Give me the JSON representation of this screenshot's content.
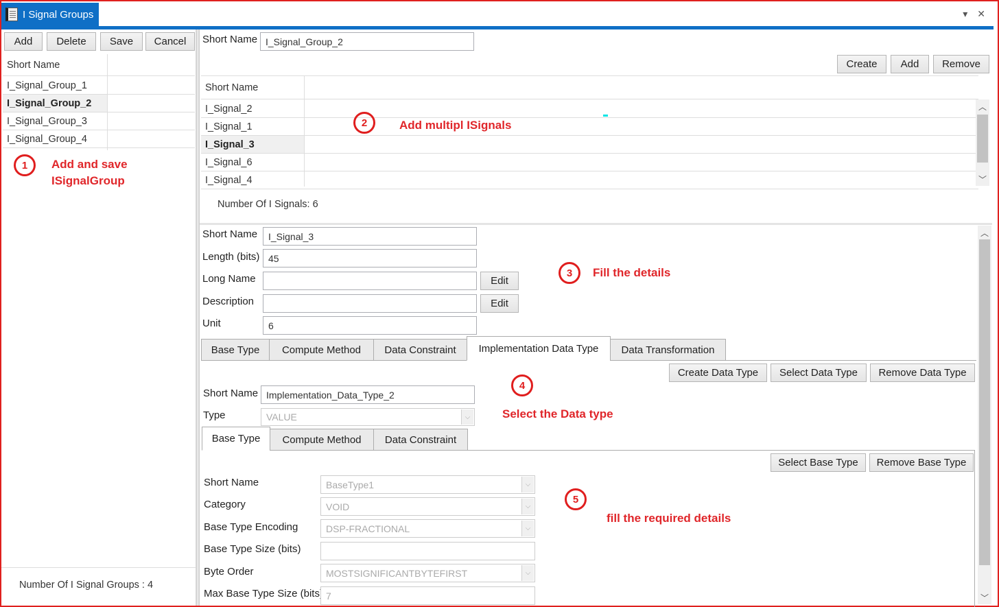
{
  "window": {
    "title": "I Signal Groups",
    "icon": "document-icon",
    "controls": {
      "menu_icon": "▾",
      "close_icon": "✕"
    }
  },
  "left": {
    "buttons": {
      "add": "Add",
      "delete": "Delete",
      "save": "Save",
      "cancel": "Cancel"
    },
    "grid": {
      "header": "Short Name",
      "rows": [
        "I_Signal_Group_1",
        "I_Signal_Group_2",
        "I_Signal_Group_3",
        "I_Signal_Group_4"
      ],
      "selected_index": 1
    },
    "count_label": "Number Of I Signal Groups : 4"
  },
  "group": {
    "short_name_label": "Short Name",
    "short_name_value": "I_Signal_Group_2",
    "buttons": {
      "create": "Create",
      "add": "Add",
      "remove": "Remove"
    },
    "grid": {
      "header": "Short Name",
      "rows": [
        "I_Signal_2",
        "I_Signal_1",
        "I_Signal_3",
        "I_Signal_6",
        "I_Signal_4"
      ],
      "selected_index": 2
    },
    "count_label": "Number Of I Signals: 6"
  },
  "signal": {
    "short_name_label": "Short Name",
    "short_name_value": "I_Signal_3",
    "length_label": "Length (bits)",
    "length_value": "45",
    "long_name_label": "Long Name",
    "long_name_value": "",
    "description_label": "Description",
    "description_value": "",
    "unit_label": "Unit",
    "unit_value": "6",
    "edit_label": "Edit",
    "tabs": [
      "Base Type",
      "Compute Method",
      "Data Constraint",
      "Implementation Data Type",
      "Data Transformation"
    ],
    "active_tab": 3
  },
  "impl_type": {
    "buttons": {
      "create": "Create Data Type",
      "select": "Select Data Type",
      "remove": "Remove Data Type"
    },
    "short_name_label": "Short Name",
    "short_name_value": "Implementation_Data_Type_2",
    "type_label": "Type",
    "type_value": "VALUE",
    "tabs": [
      "Base Type",
      "Compute Method",
      "Data Constraint"
    ],
    "active_tab": 0
  },
  "base_type": {
    "buttons": {
      "select": "Select Base Type",
      "remove": "Remove Base Type"
    },
    "fields": [
      {
        "label": "Short Name",
        "value": "BaseType1",
        "kind": "combo"
      },
      {
        "label": "Category",
        "value": "VOID",
        "kind": "combo"
      },
      {
        "label": "Base Type Encoding",
        "value": "DSP-FRACTIONAL",
        "kind": "combo"
      },
      {
        "label": "Base Type Size (bits)",
        "value": "",
        "kind": "text"
      },
      {
        "label": "Byte Order",
        "value": "MOSTSIGNIFICANTBYTEFIRST",
        "kind": "combo"
      },
      {
        "label": "Max Base Type Size (bits)",
        "value": "7",
        "kind": "text"
      }
    ]
  },
  "annotations": [
    {
      "number": "1",
      "text": "Add and save ISignalGroup"
    },
    {
      "number": "2",
      "text": "Add multipl ISignals"
    },
    {
      "number": "3",
      "text": "Fill the details"
    },
    {
      "number": "4",
      "text": "Select the Data type"
    },
    {
      "number": "5",
      "text": "fill the required details"
    }
  ],
  "colors": {
    "accent": "#0f6fc6",
    "annotation": "#e0262a",
    "frame": "#e0201e"
  }
}
